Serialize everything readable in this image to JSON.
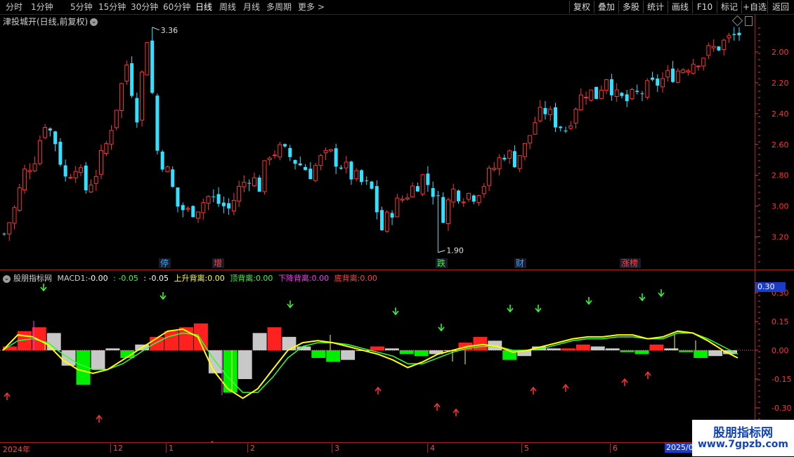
{
  "periods": [
    {
      "label": "分时",
      "active": false
    },
    {
      "label": "1分钟",
      "active": false
    },
    {
      "label": "5分钟",
      "active": false
    },
    {
      "label": "15分钟",
      "active": false
    },
    {
      "label": "30分钟",
      "active": false
    },
    {
      "label": "60分钟",
      "active": false
    },
    {
      "label": "日线",
      "active": true
    },
    {
      "label": "周线",
      "active": false
    },
    {
      "label": "月线",
      "active": false
    },
    {
      "label": "多周期",
      "active": false
    },
    {
      "label": "更多 >",
      "active": false
    }
  ],
  "toolbar": [
    "复权",
    "叠加",
    "多股",
    "统计",
    "画线",
    "F10",
    "标记",
    "+自选",
    "返回"
  ],
  "main": {
    "title": "津投城开(日线,前复权)",
    "high_label": "3.36",
    "low_label": "1.90",
    "y_ticks": [
      "3.20",
      "3.00",
      "2.80",
      "2.60",
      "2.40",
      "2.20",
      "2.00"
    ],
    "events": [
      {
        "label": "停",
        "color": "#33aaff"
      },
      {
        "label": "增",
        "color": "#ff4444"
      },
      {
        "label": "跌",
        "color": "#33ff33"
      },
      {
        "label": "财",
        "color": "#33aaff"
      },
      {
        "label": "涨榜",
        "color": "#ff4444"
      }
    ]
  },
  "indicator": {
    "name": "股朋指标网",
    "macd_label": "MACD1:",
    "macd_v1": "-0.00",
    "macd_v2": ": -0.05",
    "macd_v3": ": -0.05",
    "fields": [
      {
        "label": "上升背离:",
        "value": "0.00"
      },
      {
        "label": "顶背离:",
        "value": "0.00"
      },
      {
        "label": "下降背离:",
        "value": "0.00"
      },
      {
        "label": "底背离:",
        "value": "0.00"
      }
    ],
    "y_ticks": [
      "0.30",
      "0.15",
      "0.00",
      "-0.15",
      "-0.30"
    ],
    "current_value": "0.30"
  },
  "time_axis": {
    "labels": [
      "2024年",
      "12",
      "1",
      "2",
      "3",
      "4",
      "5",
      "6"
    ],
    "current_date": "2025/0"
  },
  "watermark": {
    "title": "股朋指标网",
    "url": "www.7gpzb.com"
  },
  "colors": {
    "up": "#ff3333",
    "down": "#33e0ff",
    "macd_pos": "#ff2020",
    "macd_neg": "#00ee00",
    "macd_fade": "#c8c8c8",
    "dif": "#ffff00",
    "dea": "#33ff33",
    "axis": "#ff3333",
    "accent": "#1a3cc8"
  },
  "chart_data": [
    {
      "type": "candlestick",
      "title": "津投城开(日线,前复权)",
      "ylim": [
        1.9,
        3.36
      ],
      "y_ticks": [
        2.0,
        2.2,
        2.4,
        2.6,
        2.8,
        3.0,
        3.2
      ],
      "close_approx": [
        2.02,
        2.18,
        2.42,
        2.52,
        2.75,
        2.62,
        2.38,
        2.48,
        2.31,
        2.42,
        2.6,
        2.85,
        3.12,
        2.8,
        3.3,
        2.56,
        2.42,
        2.2,
        2.16,
        2.2,
        2.26,
        2.22,
        2.18,
        2.31,
        2.4,
        2.33,
        2.55,
        2.56,
        2.52,
        2.47,
        2.42,
        2.5,
        2.53,
        2.47,
        2.4,
        2.35,
        2.3,
        2.05,
        2.18,
        2.25,
        2.32,
        2.39,
        2.3,
        2.15,
        2.3,
        2.28,
        2.28,
        2.35,
        2.45,
        2.55,
        2.5,
        2.58,
        2.75,
        2.82,
        2.75,
        2.7,
        2.86,
        2.95,
        2.92,
        3.05,
        2.9,
        2.88,
        2.92
      ],
      "high": 3.36,
      "low": 1.9
    },
    {
      "type": "macd",
      "ylim": [
        -0.35,
        0.35
      ],
      "y_ticks": [
        0.3,
        0.15,
        0.0,
        -0.15,
        -0.3
      ],
      "histogram": [
        0.02,
        0.1,
        0.12,
        0.09,
        -0.08,
        -0.18,
        -0.1,
        0.01,
        -0.04,
        0.03,
        0.07,
        0.1,
        0.12,
        0.14,
        -0.12,
        -0.22,
        -0.15,
        0.09,
        0.12,
        0.07,
        0.02,
        -0.04,
        -0.06,
        -0.05,
        0.0,
        0.02,
        0.01,
        -0.02,
        -0.03,
        -0.02,
        0.0,
        0.04,
        0.07,
        0.05,
        -0.05,
        -0.03,
        0.02,
        0.01,
        0.01,
        0.03,
        0.02,
        0.01,
        -0.01,
        -0.02,
        0.03,
        0.01,
        -0.01,
        -0.04,
        -0.03,
        -0.02
      ],
      "dif": [
        0.0,
        0.08,
        0.07,
        0.03,
        -0.05,
        -0.1,
        -0.12,
        -0.1,
        -0.05,
        0.0,
        0.05,
        0.1,
        0.11,
        0.07,
        -0.1,
        -0.2,
        -0.25,
        -0.2,
        -0.1,
        0.0,
        0.04,
        0.05,
        0.04,
        0.02,
        0.0,
        -0.02,
        -0.05,
        -0.09,
        -0.06,
        -0.02,
        0.0,
        0.02,
        0.03,
        0.02,
        -0.01,
        0.0,
        0.02,
        0.04,
        0.06,
        0.07,
        0.07,
        0.08,
        0.08,
        0.06,
        0.07,
        0.1,
        0.09,
        0.05,
        0.0,
        -0.04
      ],
      "dea": [
        0.0,
        0.05,
        0.06,
        0.04,
        -0.02,
        -0.07,
        -0.1,
        -0.1,
        -0.07,
        -0.02,
        0.03,
        0.07,
        0.09,
        0.08,
        -0.04,
        -0.14,
        -0.22,
        -0.22,
        -0.14,
        -0.04,
        0.02,
        0.04,
        0.04,
        0.03,
        0.01,
        -0.01,
        -0.03,
        -0.07,
        -0.07,
        -0.04,
        -0.01,
        0.01,
        0.02,
        0.02,
        0.0,
        0.0,
        0.01,
        0.03,
        0.05,
        0.06,
        0.06,
        0.07,
        0.07,
        0.06,
        0.06,
        0.09,
        0.09,
        0.06,
        0.02,
        -0.02
      ]
    }
  ]
}
